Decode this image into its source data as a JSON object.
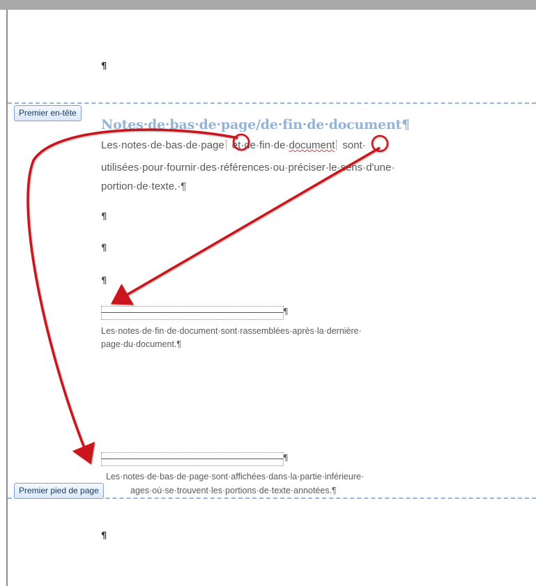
{
  "document": {
    "top_pilcrow": "¶",
    "header_tab_label": "Premier en-tête",
    "heading": "Notes·de·bas·de·page/de·fin·de·document¶",
    "body": {
      "line1_a": "Les·notes·de·bas·de·page",
      "line1_b": "et·de·fin·de·",
      "line1_c": "document",
      "line1_d": "sont·",
      "line2": "utilisées·pour·fournir·des·références·ou·préciser·le·sens·d'une·",
      "line3": "portion·de·texte.·¶"
    },
    "empty_pilcrows": [
      "¶",
      "¶",
      "¶"
    ],
    "endnote": {
      "separator_mark": "¶",
      "line1": "Les·notes·de·fin·de·document·sont·rassemblées·après·la·dernière·",
      "line2": "page·du·document.¶"
    },
    "footnote": {
      "separator_mark": "¶",
      "line1": "Les·notes·de·bas·de·page·sont·affichées·dans·la·partie·inférieure·",
      "line2": "ages·où·se·trouvent·les·portions·de·texte·annotées.¶"
    },
    "footer_tab_label": "Premier pied de page",
    "bottom_pilcrow": "¶"
  },
  "colors": {
    "heading": "#95b3d7",
    "boundary": "#93b4df",
    "arrow": "#c8171c"
  }
}
